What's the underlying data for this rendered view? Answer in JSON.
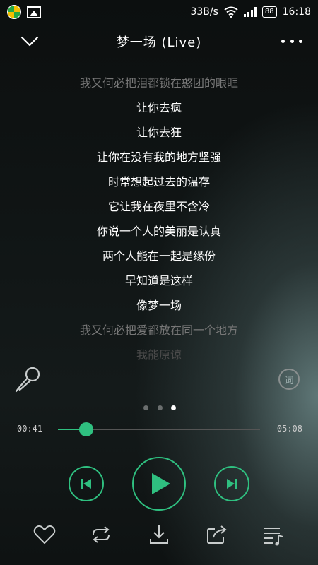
{
  "status_bar": {
    "speed": "33B/s",
    "battery": "88",
    "time": "16:18"
  },
  "header": {
    "title": "梦一场 (Live)"
  },
  "lyrics": [
    "我又何必把泪都锁在憨团的眼眶",
    "让你去疯",
    "让你去狂",
    "让你在没有我的地方坚强",
    "时常想起过去的温存",
    "它让我在夜里不含冷",
    "你说一个人的美丽是认真",
    "两个人能在一起是缘份",
    "早知道是这样",
    "像梦一场",
    "我又何必把爱都放在同一个地方",
    "我能原谅"
  ],
  "word_button_label": "词",
  "pager": {
    "count": 3,
    "active": 2
  },
  "playback": {
    "current": "00:41",
    "total": "05:08",
    "progress": 0.14
  },
  "colors": {
    "accent": "#2fc080",
    "text": "#ffffff",
    "dim_text": "#777777"
  },
  "icons": {
    "back": "chevron-down-icon",
    "more": "more-icon",
    "mic": "microphone-icon",
    "prev": "skip-previous-icon",
    "play": "play-icon",
    "next": "skip-next-icon",
    "like": "heart-icon",
    "repeat": "repeat-icon",
    "download": "download-icon",
    "share": "share-icon",
    "playlist": "playlist-icon"
  }
}
